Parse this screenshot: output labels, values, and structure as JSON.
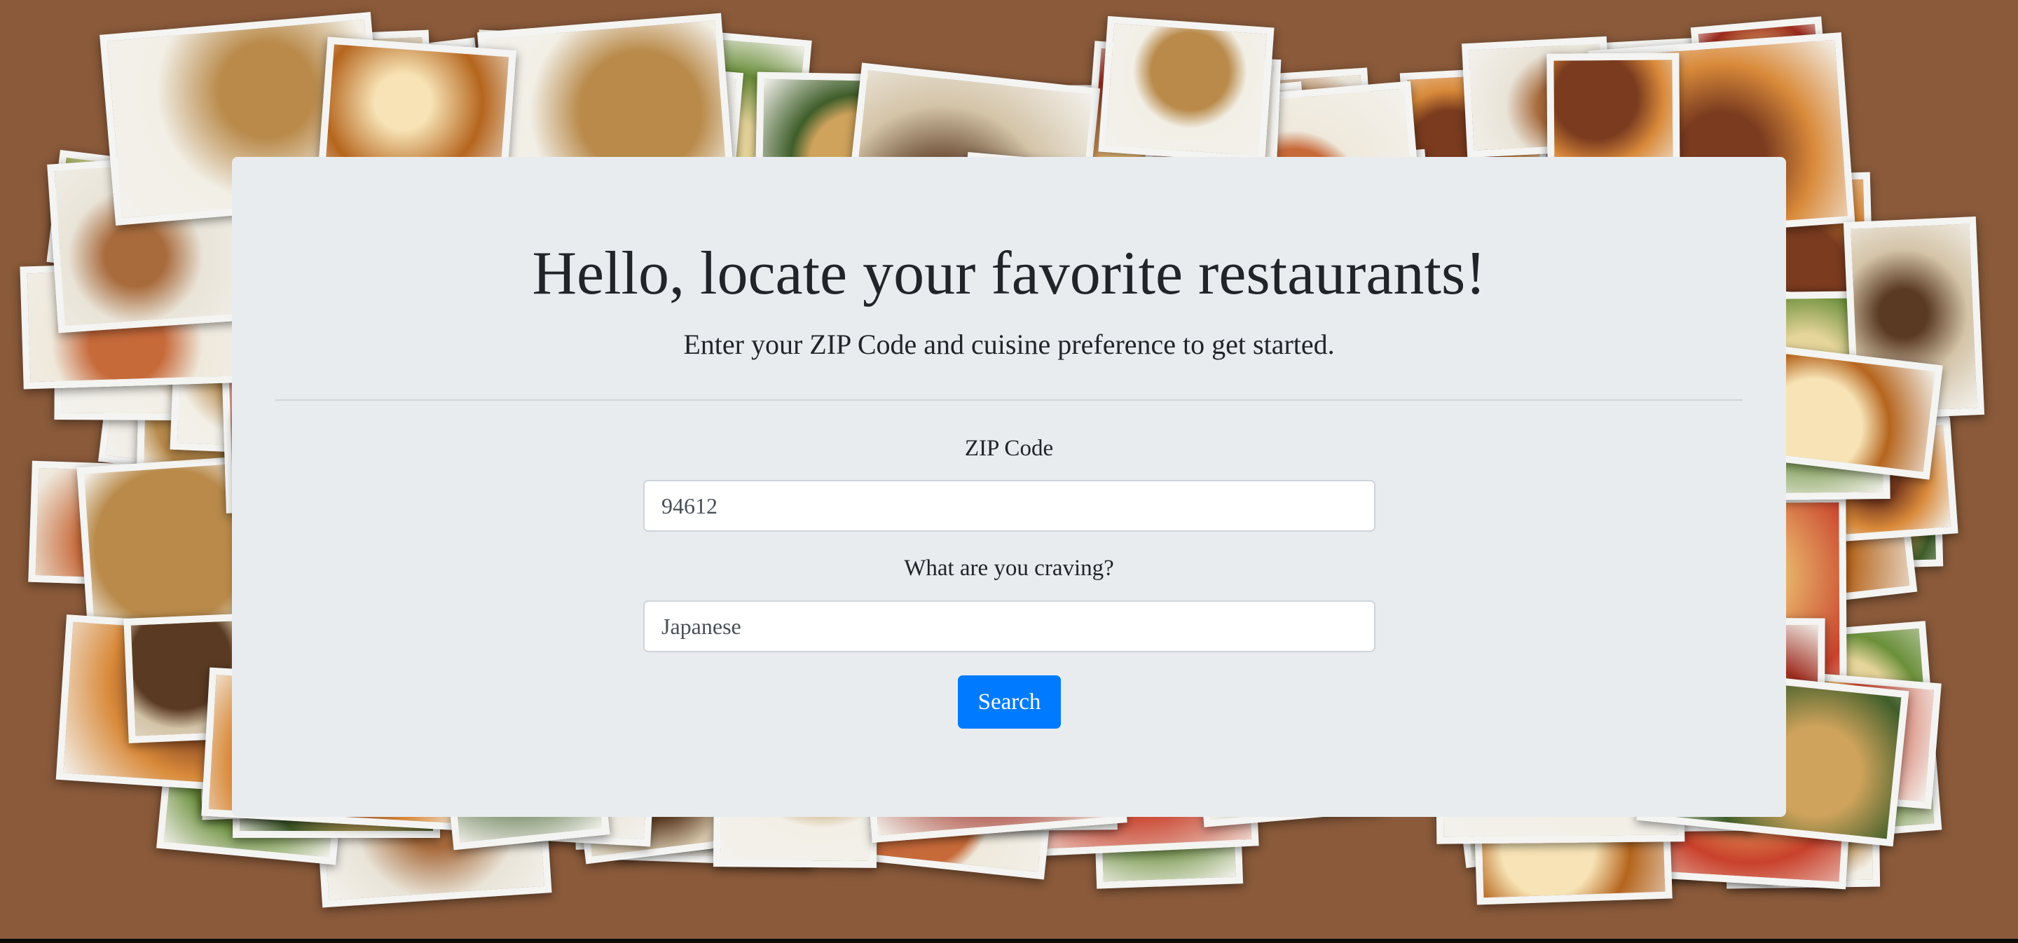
{
  "hero": {
    "title": "Hello, locate your favorite restaurants!",
    "subtitle": "Enter your ZIP Code and cuisine preference to get started."
  },
  "form": {
    "zip_label": "ZIP Code",
    "zip_value": "94612",
    "craving_label": "What are you craving?",
    "craving_value": "Japanese",
    "search_label": "Search"
  },
  "colors": {
    "card_bg": "#e9ecef",
    "button": "#007bff",
    "text": "#212529"
  }
}
